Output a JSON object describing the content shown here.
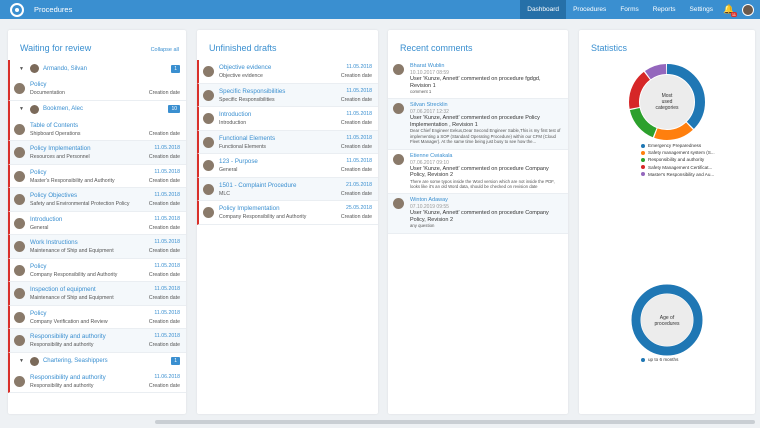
{
  "app": {
    "title": "Procedures"
  },
  "nav": {
    "tabs": [
      "Dashboard",
      "Procedures",
      "Forms",
      "Reports",
      "Settings"
    ],
    "notification_count": "11"
  },
  "waiting": {
    "title": "Waiting for review",
    "collapse": "Collapse all",
    "groups": [
      {
        "name": "Armando, Silvan",
        "count": "1"
      },
      {
        "name": "Bookmen, Alec",
        "count": "10"
      },
      {
        "name": "Chartering, Seashippers",
        "count": "1"
      }
    ],
    "rows": [
      {
        "title": "Policy",
        "sub": "Documentation",
        "date": "",
        "label": "Creation date"
      },
      {
        "title": "Table of Contents",
        "sub": "Shipboard Operations",
        "date": "",
        "label": "Creation date"
      },
      {
        "title": "Policy Implementation",
        "sub": "Resources and Personnel",
        "date": "11.05.2018",
        "label": "Creation date"
      },
      {
        "title": "Policy",
        "sub": "Master's Responsibility and Authority",
        "date": "11.05.2018",
        "label": "Creation date"
      },
      {
        "title": "Policy Objectives",
        "sub": "Safety and Environmental Protection Policy",
        "date": "11.05.2018",
        "label": "Creation date"
      },
      {
        "title": "Introduction",
        "sub": "General",
        "date": "11.05.2018",
        "label": "Creation date"
      },
      {
        "title": "Work Instructions",
        "sub": "Maintenance of Ship and Equipment",
        "date": "11.05.2018",
        "label": "Creation date"
      },
      {
        "title": "Policy",
        "sub": "Company Responsibility and Authority",
        "date": "11.05.2018",
        "label": "Creation date"
      },
      {
        "title": "Inspection of equipment",
        "sub": "Maintenance of Ship and Equipment",
        "date": "11.05.2018",
        "label": "Creation date"
      },
      {
        "title": "Policy",
        "sub": "Company Verification and Review",
        "date": "11.05.2018",
        "label": "Creation date"
      },
      {
        "title": "Responsibility and authority",
        "sub": "Responsibility and authority",
        "date": "11.05.2018",
        "label": "Creation date"
      },
      {
        "title": "Responsibility and authority",
        "sub": "Responsibility and authority",
        "date": "11.06.2018",
        "label": "Creation date"
      }
    ]
  },
  "drafts": {
    "title": "Unfinished drafts",
    "rows": [
      {
        "title": "Objective evidence",
        "sub": "Objective evidence",
        "date": "11.05.2018",
        "label": "Creation date"
      },
      {
        "title": "Specific Responsibilities",
        "sub": "Specific Responsibilities",
        "date": "11.05.2018",
        "label": "Creation date"
      },
      {
        "title": "Introduction",
        "sub": "Introduction",
        "date": "11.05.2018",
        "label": "Creation date"
      },
      {
        "title": "Functional Elements",
        "sub": "Functional Elements",
        "date": "11.05.2018",
        "label": "Creation date"
      },
      {
        "title": "123 - Purpose",
        "sub": "General",
        "date": "11.05.2018",
        "label": "Creation date"
      },
      {
        "title": "1501 - Complaint Procedure",
        "sub": "MLC",
        "date": "21.05.2018",
        "label": "Creation date"
      },
      {
        "title": "Policy Implementation",
        "sub": "Company Responsibility and Authority",
        "date": "25.05.2018",
        "label": "Creation date"
      }
    ]
  },
  "comments": {
    "title": "Recent comments",
    "items": [
      {
        "name": "Bharat Wublin",
        "date": "10.10.2017 08:59",
        "msg": "User 'Kunze, Annett' commented on procedure fgdgd, Revision 1",
        "extra": "comment 1"
      },
      {
        "name": "Silvan Strecklin",
        "date": "07.06.2017 12:32",
        "msg": "User 'Kunze, Annett' commented on procedure Policy Implementation , Revision 1",
        "extra": "Dear Chief Engineer Eekus,Dear Second Engineer Sable,This is my first test of implementing a SOP (Standard Operating Procedure) within our CFM (Cloud Fleet Manager). At the same time being just busy to see how the..."
      },
      {
        "name": "Etienne Cwiakala",
        "date": "07.06.2017 09:10",
        "msg": "User 'Kunze, Annett' commented on procedure Company Policy, Revision 2",
        "extra": "There are some typos inside the Word version which are not inside the PDF, looks like it's an old Word data, should be checked on revision date"
      },
      {
        "name": "Winton Adaway",
        "date": "07.10.2019 09:55",
        "msg": "User 'Kunze, Annett' commented on procedure Company Policy, Revision 2",
        "extra": "any question"
      }
    ]
  },
  "stats": {
    "title": "Statistics",
    "donut1": {
      "center": [
        "Most",
        "used",
        "categories"
      ],
      "legend": [
        "Emergency Preparedness",
        "Safety management system (S...",
        "Responsibility and authority",
        "Safety Management Certificat...",
        "Master's Responsibility and Au..."
      ],
      "colors": [
        "#1f77b4",
        "#ff7f0e",
        "#2ca02c",
        "#d62728",
        "#9467bd"
      ],
      "shares": [
        0.38,
        0.18,
        0.16,
        0.18,
        0.1
      ]
    },
    "donut2": {
      "center": [
        "Age of",
        "procedures"
      ],
      "legend": [
        "up to 6 months"
      ],
      "colors": [
        "#1f77b4"
      ]
    }
  }
}
